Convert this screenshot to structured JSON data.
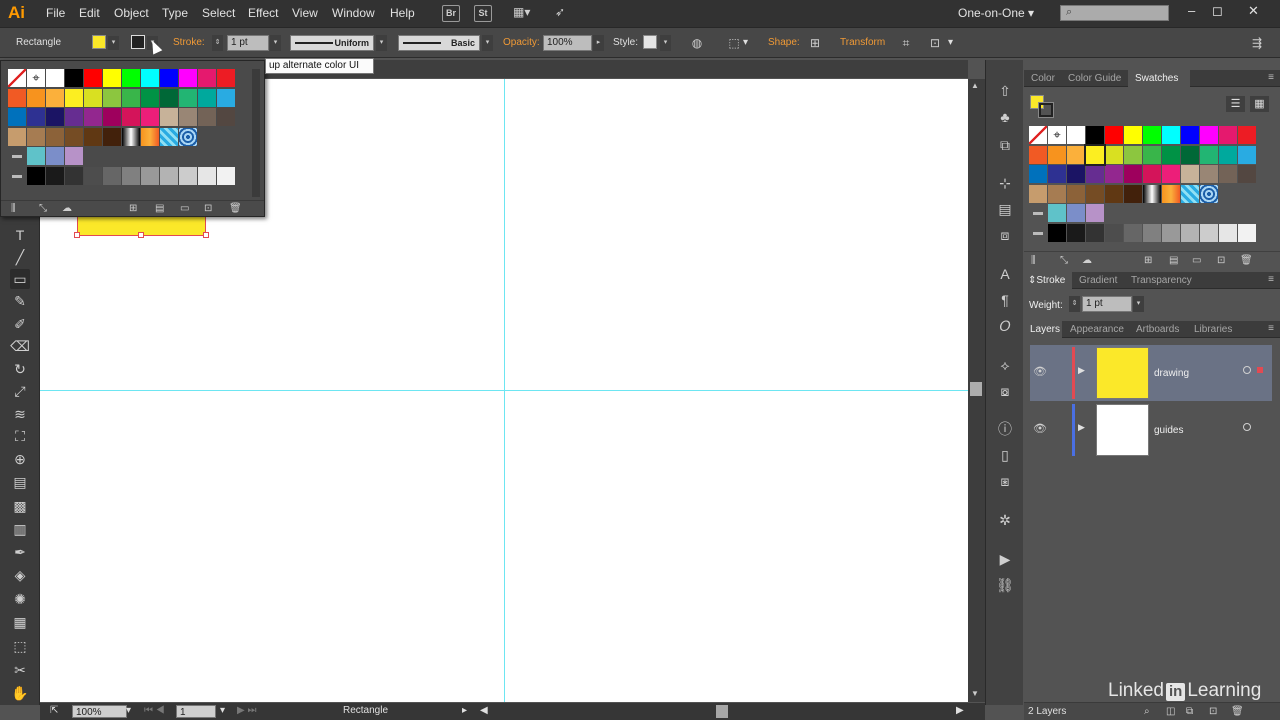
{
  "app": {
    "logo": "Ai"
  },
  "menu": [
    "File",
    "Edit",
    "Object",
    "Type",
    "Select",
    "Effect",
    "View",
    "Window",
    "Help"
  ],
  "menu_buttons": [
    "Br",
    "St"
  ],
  "workspace": "One-on-One",
  "window_controls": [
    "–",
    "◻",
    "✕"
  ],
  "control": {
    "tool_name": "Rectangle",
    "stroke_label": "Stroke:",
    "stroke_weight": "1 pt",
    "profile": "Uniform",
    "brush": "Basic",
    "opacity_label": "Opacity:",
    "opacity_value": "100%",
    "style_label": "Style:",
    "shape_label": "Shape:",
    "transform_label": "Transform",
    "fill_color": "#fbe829"
  },
  "tooltip": "up alternate color UI",
  "status": {
    "zoom": "100%",
    "artboard": "1",
    "tool": "Rectangle"
  },
  "panels": {
    "color_tabs": [
      "Color",
      "Color Guide",
      "Swatches"
    ],
    "stroke_tabs": [
      "Stroke",
      "Gradient",
      "Transparency"
    ],
    "weight_label": "Weight:",
    "weight_value": "1 pt",
    "layers_tabs": [
      "Layers",
      "Appearance",
      "Artboards",
      "Libraries"
    ],
    "layers": [
      {
        "name": "drawing",
        "color": "#e24a52",
        "thumb": "#fbe829"
      },
      {
        "name": "guides",
        "color": "#4a6fe2",
        "thumb": "#ffffff"
      }
    ],
    "layers_count": "2 Layers"
  },
  "watermark": {
    "a": "Linked",
    "b": "in",
    "c": "Learning"
  },
  "swatch_rows": [
    [
      "none",
      "reg",
      "#ffffff",
      "#000000",
      "#ff0000",
      "#ffff00",
      "#00ff00",
      "#00ffff",
      "#0000ff",
      "#ff00ff",
      "#e5196e",
      "#ed1c24"
    ],
    [
      "#f15a24",
      "#f7931e",
      "#fbb03b",
      "#fcee21",
      "#d9e021",
      "#8cc63f",
      "#39b54a",
      "#009245",
      "#006837",
      "#22b573",
      "#00a99d",
      "#29abe2"
    ],
    [
      "#0071bc",
      "#2e3192",
      "#1b1464",
      "#662d91",
      "#93278f",
      "#9e005d",
      "#d4145a",
      "#ed1e79",
      "#c7b299",
      "#998675",
      "#736357",
      "#534741"
    ],
    [
      "#c69c6d",
      "#a67c52",
      "#8c6239",
      "#754c24",
      "#603813",
      "#42210b",
      "grad-bw",
      "grad-or",
      "grad-cy",
      "pattern"
    ],
    [
      "folder",
      "#5fc2c9",
      "#7b8ec9",
      "#b792c8"
    ],
    [
      "folder",
      "#000000",
      "#1a1a1a",
      "#333333",
      "#4d4d4d",
      "#666666",
      "#808080",
      "#999999",
      "#b3b3b3",
      "#cccccc",
      "#e6e6e6",
      "#f2f2f2"
    ]
  ]
}
